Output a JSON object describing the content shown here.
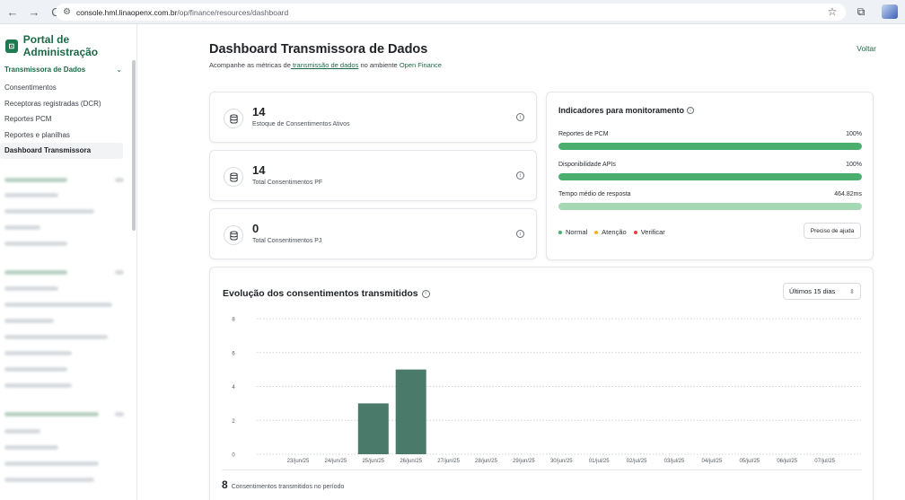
{
  "browser": {
    "url_host": "console.hml.linaopenx.com.br",
    "url_path": "/op/finance/resources/dashboard"
  },
  "sidebar": {
    "brand": "Portal de Administração",
    "section_title": "Transmissora de Dados",
    "items": [
      {
        "label": "Consentimentos",
        "active": false
      },
      {
        "label": "Receptoras registradas (DCR)",
        "active": false
      },
      {
        "label": "Reportes PCM",
        "active": false
      },
      {
        "label": "Reportes e planilhas",
        "active": false
      },
      {
        "label": "Dashboard Transmissora",
        "active": true
      }
    ]
  },
  "header": {
    "title": "Dashboard Transmissora de Dados",
    "subtitle_prefix": "Acompanhe as métricas de",
    "subtitle_link": " transmissão de dados",
    "subtitle_middle": " no ambiente ",
    "subtitle_env": "Open Finance",
    "back_label": "Voltar"
  },
  "stats": [
    {
      "value": "14",
      "label": "Estoque de Consentimentos Ativos"
    },
    {
      "value": "14",
      "label": "Total Consentimentos PF"
    },
    {
      "value": "0",
      "label": "Total Consentimentos PJ"
    }
  ],
  "indicators": {
    "title": "Indicadores para monitoramento",
    "rows": [
      {
        "label": "Reportes de PCM",
        "value": "100%",
        "fill": 1.0
      },
      {
        "label": "Disponibilidade APIs",
        "value": "100%",
        "fill": 1.0
      },
      {
        "label": "Tempo médio de resposta",
        "value": "464.82ms",
        "fill": 1.0
      }
    ],
    "legend": [
      {
        "label": "Normal",
        "color": "#3fb366"
      },
      {
        "label": "Atenção",
        "color": "#f2b01e"
      },
      {
        "label": "Verificar",
        "color": "#e0463b"
      }
    ],
    "help_label": "Preciso de ajuda"
  },
  "chart_section": {
    "title": "Evolução dos consentimentos transmitidos",
    "range_label": "Últimos 15 dias",
    "total_value": "8",
    "total_label": "Consentimentos transmitidos no período"
  },
  "chart_data": {
    "type": "bar",
    "categories": [
      "23/jun/25",
      "24/jun/25",
      "25/jun/25",
      "26/jun/25",
      "27/jun/25",
      "28/jun/25",
      "29/jun/25",
      "30/jun/25",
      "01/jul/25",
      "02/jul/25",
      "03/jul/25",
      "04/jul/25",
      "05/jul/25",
      "06/jul/25",
      "07/jul/25"
    ],
    "values": [
      0,
      0,
      3,
      5,
      0,
      0,
      0,
      0,
      0,
      0,
      0,
      0,
      0,
      0,
      0
    ],
    "yticks": [
      0,
      2,
      4,
      6,
      8
    ],
    "ylim": [
      0,
      8
    ],
    "bar_color": "#4a7a6a",
    "grid": true,
    "title": "",
    "xlabel": "",
    "ylabel": ""
  }
}
